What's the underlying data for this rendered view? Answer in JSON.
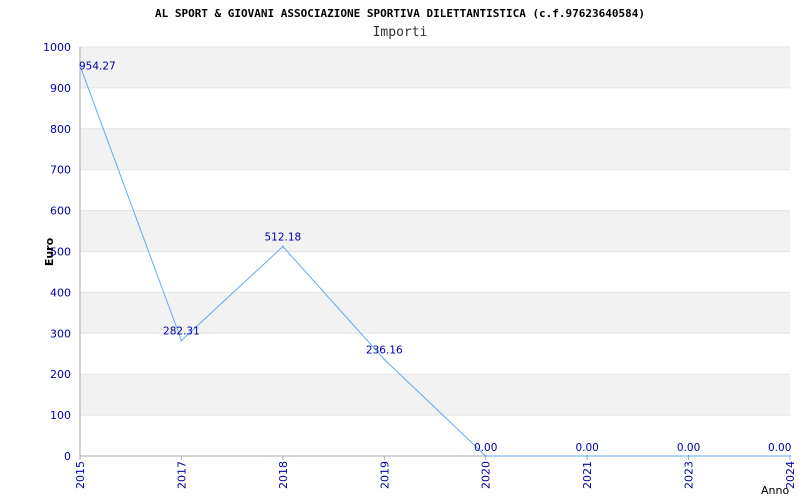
{
  "chart_data": {
    "type": "line",
    "title": "AL SPORT & GIOVANI ASSOCIAZIONE SPORTIVA DILETTANTISTICA (c.f.97623640584)",
    "subtitle": "Importi",
    "xlabel": "Anno",
    "ylabel": "Euro",
    "categories": [
      "2015",
      "2017",
      "2018",
      "2019",
      "2020",
      "2021",
      "2023",
      "2024"
    ],
    "values": [
      954.27,
      282.31,
      512.18,
      236.16,
      0.0,
      0.0,
      0.0,
      0.0
    ],
    "data_labels": [
      "954.27",
      "282.31",
      "512.18",
      "236.16",
      "0.00",
      "0.00",
      "0.00",
      "0.00"
    ],
    "ylim": [
      0,
      1000
    ],
    "yticks": [
      0,
      100,
      200,
      300,
      400,
      500,
      600,
      700,
      800,
      900,
      1000
    ],
    "grid": "horizontal alternating bands",
    "colors": {
      "line": "#66aaee",
      "band": "#f2f2f2",
      "text": "#0000aa",
      "axis": "#aaaaaa"
    }
  }
}
